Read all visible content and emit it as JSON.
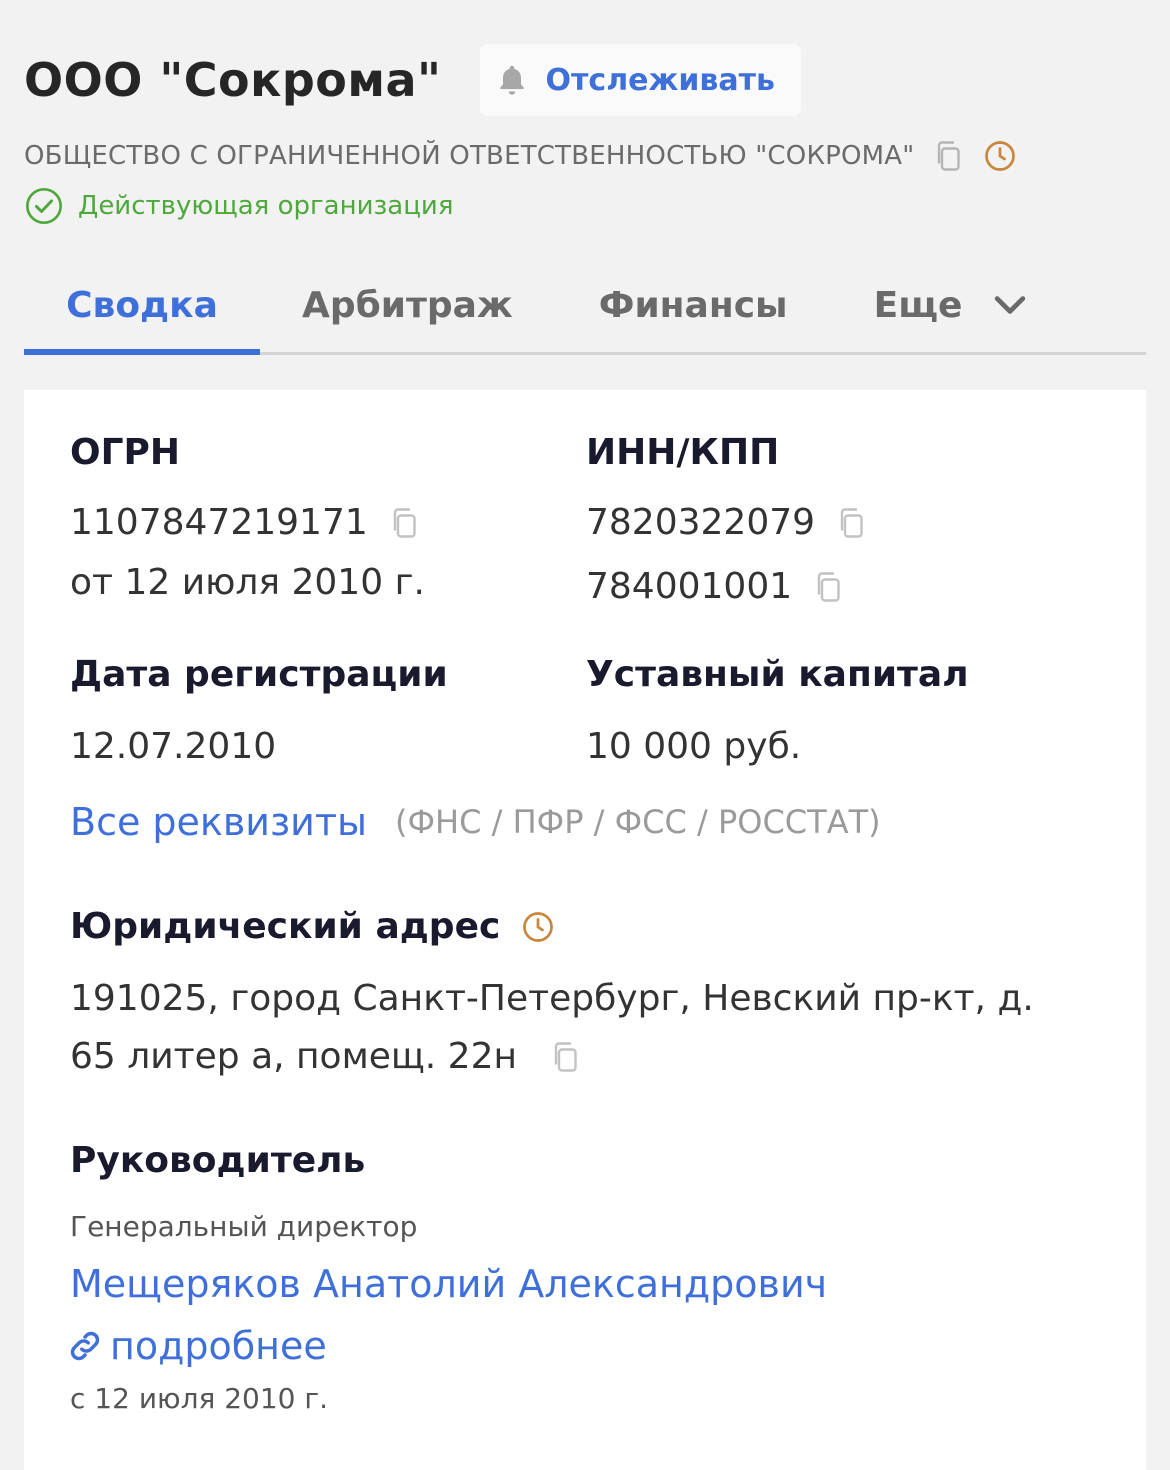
{
  "company": {
    "short_name": "ООО \"Сокрома\"",
    "track_label": "Отслеживать",
    "full_name": "ОБЩЕСТВО С ОГРАНИЧЕННОЙ ОТВЕТСТВЕННОСТЬЮ \"СОКРОМА\"",
    "status": "Действующая организация"
  },
  "tabs": [
    {
      "label": "Сводка",
      "active": true
    },
    {
      "label": "Арбитраж",
      "active": false
    },
    {
      "label": "Финансы",
      "active": false
    },
    {
      "label": "Еще",
      "active": false
    }
  ],
  "requisites": {
    "ogrn_label": "ОГРН",
    "ogrn_value": "1107847219171",
    "ogrn_date": "от 12 июля 2010 г.",
    "inn_kpp_label": "ИНН/КПП",
    "inn_value": "7820322079",
    "kpp_value": "784001001",
    "reg_date_label": "Дата регистрации",
    "reg_date_value": "12.07.2010",
    "capital_label": "Уставный капитал",
    "capital_value": "10 000 руб.",
    "all_link": "Все реквизиты",
    "sources": "(ФНС / ПФР / ФСС / РОССТАТ)"
  },
  "address": {
    "label": "Юридический адрес",
    "line1": "191025, город Санкт-Петербург, Невский пр-кт, д.",
    "line2": "65 литер а, помещ. 22н"
  },
  "head": {
    "label": "Руководитель",
    "position": "Генеральный директор",
    "name": "Мещеряков Анатолий Александрович",
    "more_link": "подробнее",
    "since": "с 12 июля 2010 г."
  },
  "colors": {
    "accent": "#3f6fd8",
    "status_green": "#4ea83c",
    "history_orange": "#c8873a",
    "background": "#f2f2f2"
  },
  "icons": [
    "bell-icon",
    "copy-icon",
    "history-icon",
    "check-circle-icon",
    "chevron-down-icon",
    "link-icon"
  ]
}
